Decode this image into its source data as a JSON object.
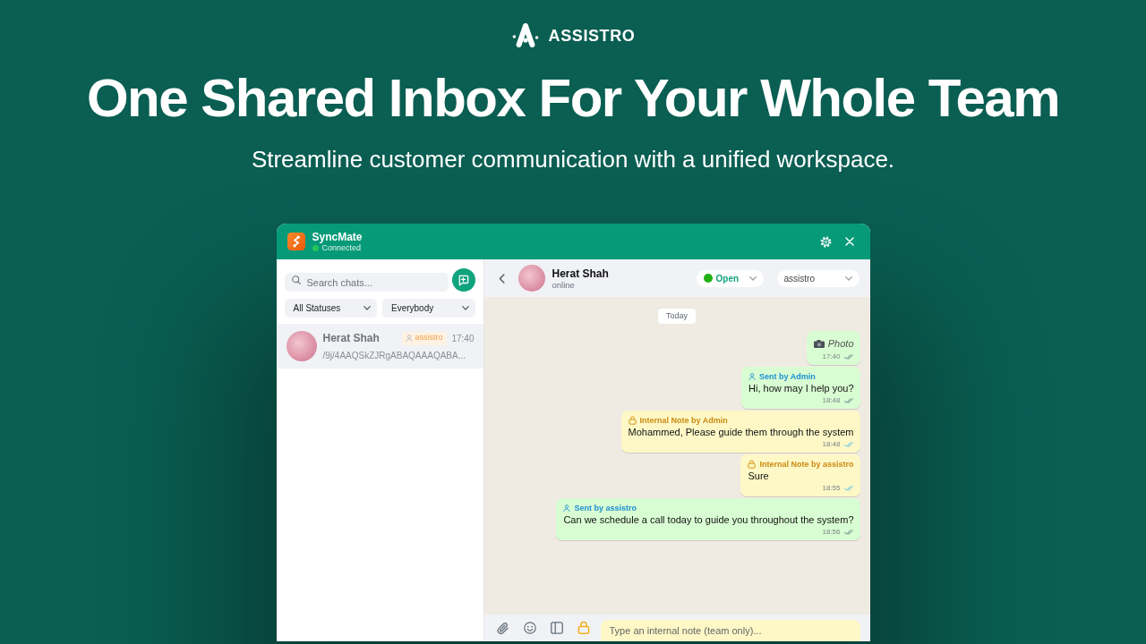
{
  "brand": {
    "name": "ASSISTRO"
  },
  "hero": {
    "title": "One Shared Inbox For Your Whole Team",
    "subtitle": "Streamline customer communication with a unified workspace."
  },
  "app": {
    "header": {
      "title": "SyncMate",
      "connection": {
        "label": "Connected",
        "online": true
      }
    },
    "sidebar": {
      "search": {
        "placeholder": "Search chats..."
      },
      "filters": [
        {
          "value": "All Statuses"
        },
        {
          "value": "Everybody"
        }
      ],
      "chats": [
        {
          "name": "Herat Shah",
          "agent": "assistro",
          "time": "17:40",
          "preview": "/9j/4AAQSkZJRgABAQAAAQABA...",
          "selected": true
        }
      ]
    },
    "chat": {
      "contact": {
        "name": "Herat Shah",
        "presence": "online"
      },
      "status": "Open",
      "assignee": "assistro",
      "date_divider": "Today",
      "messages": [
        {
          "kind": "photo",
          "text": "Photo",
          "time": "17:40",
          "read": false
        },
        {
          "kind": "sent",
          "header": "Sent by Admin",
          "text": "Hi, how may I help you?",
          "time": "18:48",
          "read": false
        },
        {
          "kind": "note",
          "header": "Internal Note by Admin",
          "text": "Mohammed, Please guide them through the system",
          "time": "18:48",
          "read": true
        },
        {
          "kind": "note",
          "header": "Internal Note by assistro",
          "text": "Sure",
          "time": "18:55",
          "read": true
        },
        {
          "kind": "sent",
          "header": "Sent by assistro",
          "text": "Can we schedule a call today to guide you throughout the system?",
          "time": "18:56",
          "read": false
        }
      ]
    },
    "composer": {
      "placeholder": "Type an internal note (team only)...",
      "note_mode": true
    }
  }
}
